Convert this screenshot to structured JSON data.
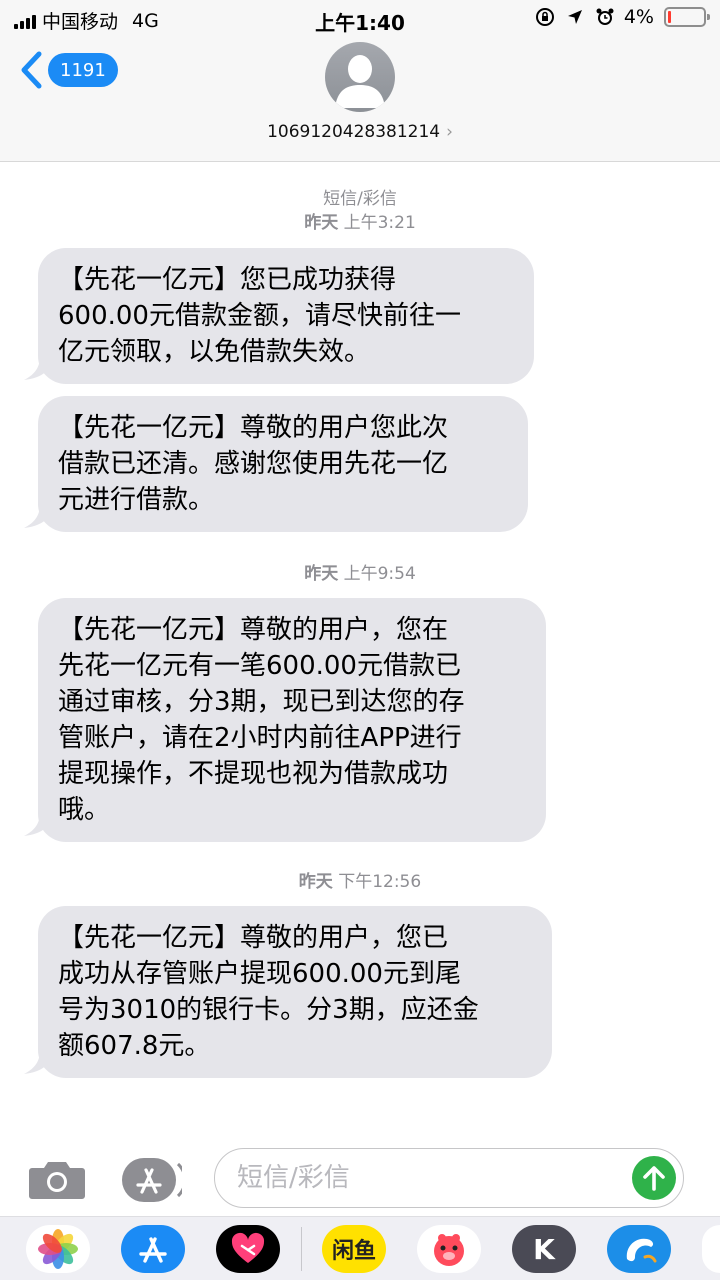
{
  "status_bar": {
    "carrier": "中国移动",
    "network": "4G",
    "time": "上午1:40",
    "battery": "4%",
    "battery_level": 0.04
  },
  "header": {
    "back_count": "1191",
    "contact_number": "1069120428381214",
    "contact_chevron": "›"
  },
  "thread": {
    "service_label": "短信/彩信",
    "groups": [
      {
        "day": "昨天",
        "time": "上午3:21",
        "messages": [
          {
            "lines": [
              "【先花一亿元】您已成功获得",
              "600.00元借款金额，请尽快前往一",
              "亿元领取，以免借款失效。"
            ]
          },
          {
            "lines": [
              "【先花一亿元】尊敬的用户您此次",
              "借款已还清。感谢您使用先花一亿",
              "元进行借款。"
            ]
          }
        ]
      },
      {
        "day": "昨天",
        "time": "上午9:54",
        "messages": [
          {
            "lines": [
              "【先花一亿元】尊敬的用户，您在",
              "先花一亿元有一笔600.00元借款已",
              "通过审核，分3期，现已到达您的存",
              "管账户，请在2小时内前往APP进行",
              "提现操作，不提现也视为借款成功",
              "哦。"
            ]
          }
        ]
      },
      {
        "day": "昨天",
        "time": "下午12:56",
        "messages": [
          {
            "lines": [
              "【先花一亿元】尊敬的用户，您已",
              "成功从存管账户提现600.00元到尾",
              "号为3010的银行卡。分3期，应还金",
              "额607.8元。"
            ]
          }
        ]
      }
    ]
  },
  "input": {
    "placeholder": "短信/彩信"
  },
  "drawer": {
    "apps": [
      {
        "icon": "photos-icon"
      },
      {
        "icon": "app-store-icon"
      },
      {
        "icon": "heart-app-icon"
      },
      {
        "icon": "xianyu-icon",
        "label": "闲鱼"
      },
      {
        "icon": "pig-app-icon"
      },
      {
        "icon": "k-app-icon",
        "label": "K"
      },
      {
        "icon": "dolphin-app-icon"
      },
      {
        "icon": "partial-app-icon"
      }
    ]
  },
  "colors": {
    "accent_blue": "#1b8bf5",
    "bubble_gray": "#e5e5ea",
    "send_green": "#2fb24a",
    "battery_red": "#ff3b30"
  }
}
